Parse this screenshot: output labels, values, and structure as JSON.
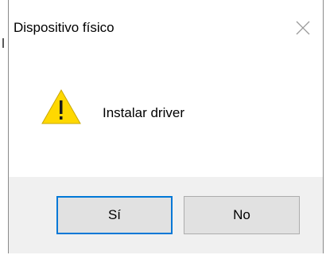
{
  "dialog": {
    "title": "Dispositivo físico",
    "close_icon": "close-icon",
    "message": "Instalar driver",
    "icon": "warning-icon",
    "buttons": {
      "yes_label": "Sí",
      "no_label": "No"
    }
  },
  "colors": {
    "focus_border": "#0078d7",
    "footer_bg": "#f0f0f0",
    "button_bg": "#e1e1e1",
    "warning_fill": "#ffd800"
  }
}
